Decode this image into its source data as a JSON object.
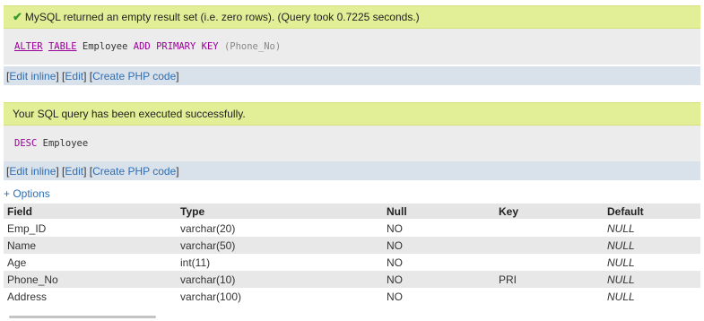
{
  "message1": {
    "text": "MySQL returned an empty result set (i.e. zero rows). (Query took 0.7225 seconds.)",
    "icon": "check-icon"
  },
  "query1": {
    "kw1": "ALTER",
    "kw2": "TABLE",
    "table": "Employee",
    "kw3": "ADD PRIMARY KEY",
    "column": "(Phone_No)"
  },
  "links": {
    "open": "[",
    "edit_inline": "Edit inline",
    "sep1": "] [",
    "edit": "Edit",
    "sep2": "] [",
    "create_php": "Create PHP code",
    "close": "]"
  },
  "message2": {
    "text": "Your SQL query has been executed successfully."
  },
  "query2": {
    "kw": "DESC",
    "table": "Employee"
  },
  "options_label": "+ Options",
  "table": {
    "headers": [
      "Field",
      "Type",
      "Null",
      "Key",
      "Default"
    ],
    "rows": [
      [
        "Emp_ID",
        "varchar(20)",
        "NO",
        "",
        "NULL"
      ],
      [
        "Name",
        "varchar(50)",
        "NO",
        "",
        "NULL"
      ],
      [
        "Age",
        "int(11)",
        "NO",
        "",
        "NULL"
      ],
      [
        "Phone_No",
        "varchar(10)",
        "NO",
        "PRI",
        "NULL"
      ],
      [
        "Address",
        "varchar(100)",
        "NO",
        "",
        "NULL"
      ]
    ]
  },
  "colors": {
    "success_bg": "#e3ef96",
    "query_bg": "#ececec",
    "links_bg": "#d9e2ea",
    "link": "#2e6eb5",
    "keyword": "#990099"
  }
}
